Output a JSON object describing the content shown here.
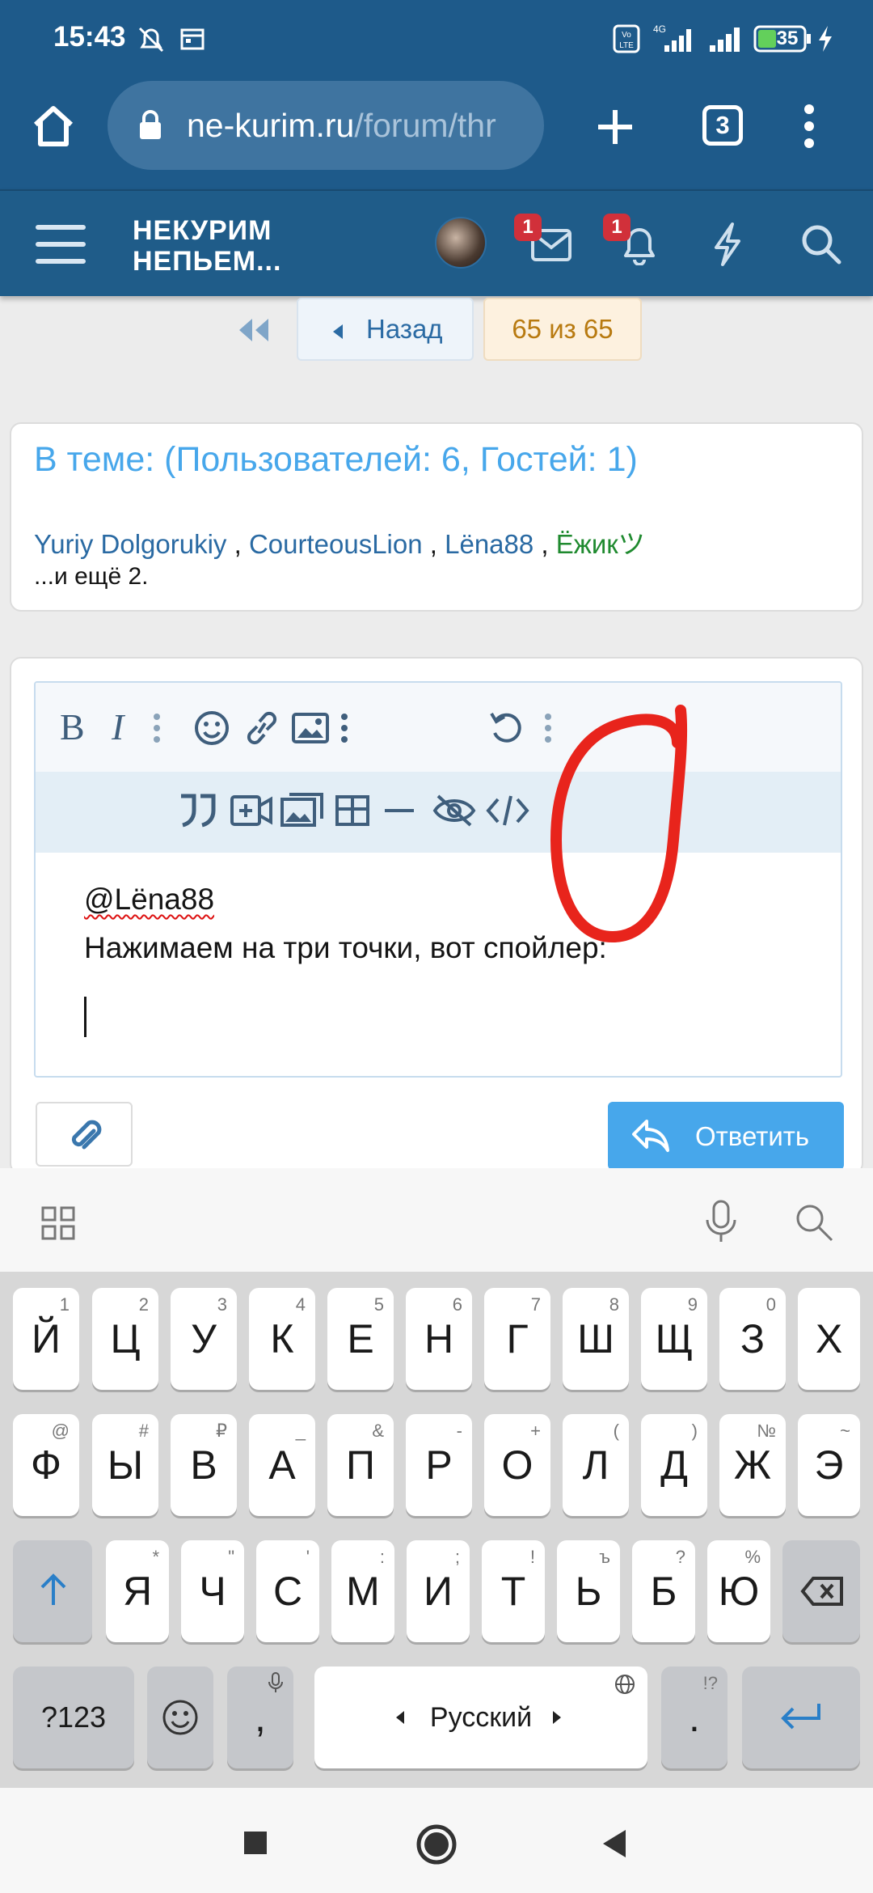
{
  "status_bar": {
    "time": "15:43",
    "battery": "35",
    "network": "4G",
    "lte": "Vo LTE"
  },
  "browser": {
    "url_host": "ne-kurim.ru",
    "url_path": "/forum/thr",
    "tab_count": "3"
  },
  "site": {
    "logo_line1": "НЕКУРИМ",
    "logo_line2": "НЕПЬЕМ...",
    "inbox_badge": "1",
    "alerts_badge": "1"
  },
  "page_nav": {
    "back_label": "Назад",
    "page_indicator": "65 из 65"
  },
  "who": {
    "title": "В теме: (Пользователей: 6, Гостей: 1)",
    "users": [
      "Yuriy Dolgorukiy",
      "CourteousLion",
      "Lëna88",
      "Ёжикツ"
    ],
    "separator": " , ",
    "more": "...и ещё 2."
  },
  "editor": {
    "line1": "@Lëna88",
    "line2": "Нажимаем на три точки, вот спойлер:"
  },
  "reply_button": {
    "label": "Ответить"
  },
  "keyboard": {
    "row1": [
      [
        "Й",
        "1"
      ],
      [
        "Ц",
        "2"
      ],
      [
        "У",
        "3"
      ],
      [
        "К",
        "4"
      ],
      [
        "Е",
        "5"
      ],
      [
        "Н",
        "6"
      ],
      [
        "Г",
        "7"
      ],
      [
        "Ш",
        "8"
      ],
      [
        "Щ",
        "9"
      ],
      [
        "З",
        "0"
      ],
      [
        "Х",
        ""
      ]
    ],
    "row2": [
      [
        "Ф",
        "@"
      ],
      [
        "Ы",
        "#"
      ],
      [
        "В",
        "₽"
      ],
      [
        "А",
        "_"
      ],
      [
        "П",
        "&"
      ],
      [
        "Р",
        "-"
      ],
      [
        "О",
        "+"
      ],
      [
        "Л",
        "("
      ],
      [
        "Д",
        ")"
      ],
      [
        "Ж",
        "№"
      ],
      [
        "Э",
        "~"
      ]
    ],
    "row3": [
      [
        "Я",
        "*"
      ],
      [
        "Ч",
        "\""
      ],
      [
        "С",
        "'"
      ],
      [
        "М",
        ":"
      ],
      [
        "И",
        ";"
      ],
      [
        "Т",
        "!"
      ],
      [
        "Ь",
        "ъ"
      ],
      [
        "Б",
        "?"
      ],
      [
        "Ю",
        "%"
      ]
    ],
    "symbols_key": "?123",
    "comma_key": ",",
    "space_label": "Русский",
    "period_key": ".",
    "period_hint": "!?"
  },
  "colors": {
    "header": "#1f5c89",
    "accent": "#47a7eb",
    "annotation": "#e8241c"
  },
  "icons": [
    "home-icon",
    "lock-icon",
    "plus-icon",
    "more-icon",
    "menu-icon",
    "mail-icon",
    "bell-icon",
    "bolt-icon",
    "search-icon",
    "bold-icon",
    "italic-icon",
    "smile-icon",
    "link-icon",
    "image-icon",
    "undo-icon",
    "quote-icon",
    "video-icon",
    "gallery-icon",
    "table-icon",
    "hr-icon",
    "spoiler-icon",
    "code-icon",
    "paperclip-icon",
    "reply-icon",
    "grid-icon",
    "mic-icon",
    "shift-icon",
    "backspace-icon",
    "emoji-icon",
    "globe-icon",
    "enter-icon"
  ]
}
